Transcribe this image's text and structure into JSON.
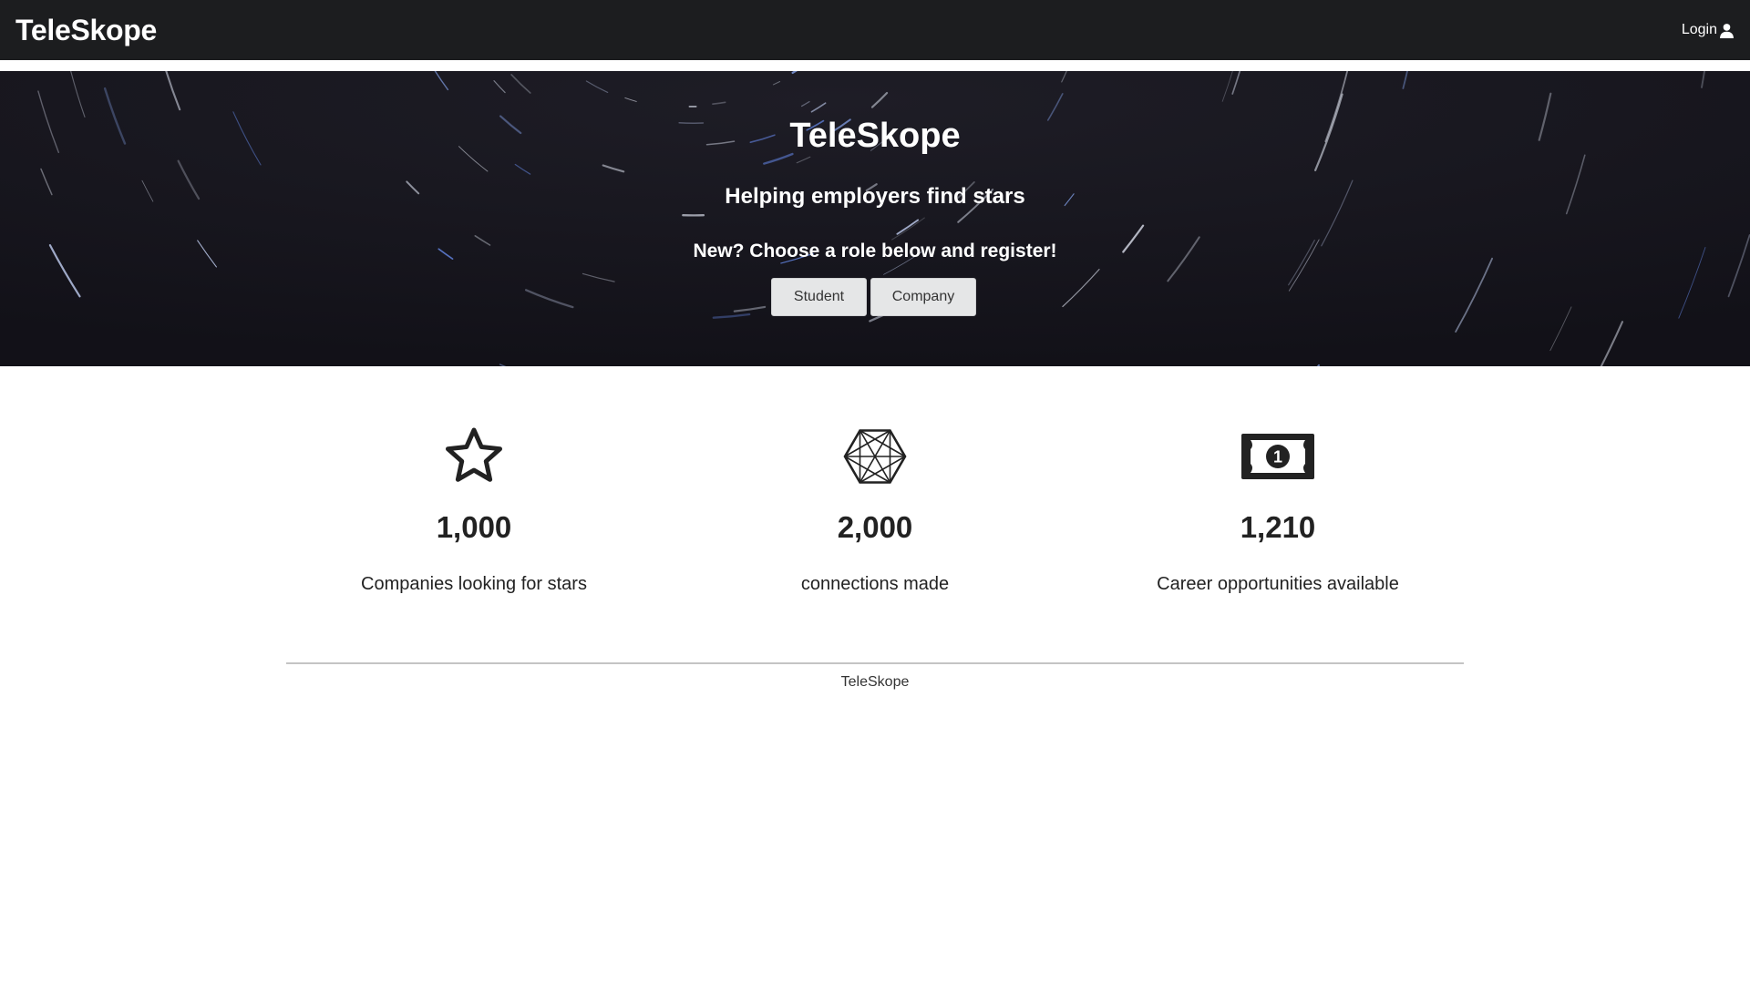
{
  "navbar": {
    "brand": "TeleSkope",
    "login_label": "Login",
    "login_icon": "user-icon"
  },
  "hero": {
    "title": "TeleSkope",
    "subtitle": "Helping employers find stars",
    "cta": "New? Choose a role below and register!",
    "buttons": {
      "student": "Student",
      "company": "Company"
    },
    "background": "star-trails-image"
  },
  "stats": [
    {
      "icon": "star-icon",
      "value": "1,000",
      "label": "Companies looking for stars"
    },
    {
      "icon": "network-hexagon-icon",
      "value": "2,000",
      "label": "connections made"
    },
    {
      "icon": "money-bill-icon",
      "value": "1,210",
      "label": "Career opportunities available"
    }
  ],
  "footer": {
    "text": "TeleSkope"
  },
  "colors": {
    "navbar_bg": "#1c1d1f",
    "hero_bg": "#16151b",
    "button_bg": "#e5e6e7",
    "text_dark": "#222222"
  }
}
